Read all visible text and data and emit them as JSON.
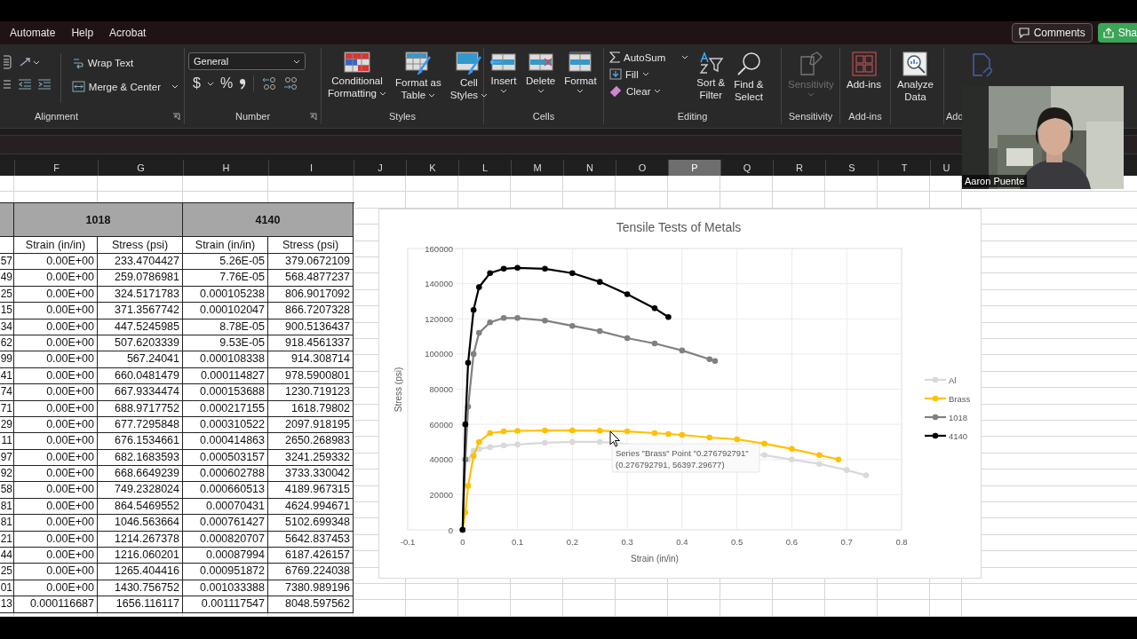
{
  "menu_tabs": [
    {
      "label": "Automate"
    },
    {
      "label": "Help"
    },
    {
      "label": "Acrobat"
    }
  ],
  "menubar": {
    "comments": "Comments",
    "share": "Sha"
  },
  "ribbon": {
    "alignment": {
      "wrap_text": "Wrap Text",
      "merge_center": "Merge & Center",
      "label": "Alignment"
    },
    "number": {
      "format": "General",
      "currency": "$",
      "percent": "%",
      "label": "Number"
    },
    "styles": {
      "buttons": [
        {
          "lines": [
            "Conditional",
            "Formatting"
          ]
        },
        {
          "lines": [
            "Format as",
            "Table"
          ]
        },
        {
          "lines": [
            "Cell",
            "Styles"
          ]
        }
      ],
      "label": "Styles"
    },
    "cells": {
      "buttons": [
        {
          "label": "Insert"
        },
        {
          "label": "Delete"
        },
        {
          "label": "Format"
        }
      ],
      "label": "Cells"
    },
    "editing": {
      "autosum": "AutoSum",
      "fill": "Fill",
      "clear": "Clear",
      "sort": [
        "Sort &",
        "Filter"
      ],
      "find": [
        "Find &",
        "Select"
      ],
      "label": "Editing"
    },
    "sensitivity": {
      "button": "Sensitivity",
      "disabled": true,
      "label": "Sensitivity"
    },
    "addins": {
      "button": "Add-ins",
      "label": "Add-ins"
    },
    "analyze": {
      "lines": [
        "Analyze",
        "Data"
      ]
    },
    "partial_group": {
      "label": "Add"
    }
  },
  "column_headers": [
    {
      "letter": "F",
      "selected": false
    },
    {
      "letter": "G",
      "selected": false
    },
    {
      "letter": "H",
      "selected": false
    },
    {
      "letter": "I",
      "selected": false
    },
    {
      "letter": "J",
      "selected": false
    },
    {
      "letter": "K",
      "selected": false
    },
    {
      "letter": "L",
      "selected": false
    },
    {
      "letter": "M",
      "selected": false
    },
    {
      "letter": "N",
      "selected": false
    },
    {
      "letter": "O",
      "selected": false
    },
    {
      "letter": "P",
      "selected": true
    },
    {
      "letter": "Q",
      "selected": false
    },
    {
      "letter": "R",
      "selected": false
    },
    {
      "letter": "S",
      "selected": false
    },
    {
      "letter": "T",
      "selected": false
    },
    {
      "letter": "U",
      "selected": false
    }
  ],
  "table": {
    "groups": [
      "1018",
      "4140"
    ],
    "columns": [
      "",
      "Strain (in/in)",
      "Stress (psi)",
      "Strain (in/in)",
      "Stress (psi)"
    ],
    "rows": [
      [
        "57",
        "0.00E+00",
        "233.4704427",
        "5.26E-05",
        "379.0672109"
      ],
      [
        "49",
        "0.00E+00",
        "259.0786981",
        "7.76E-05",
        "568.4877237"
      ],
      [
        "25",
        "0.00E+00",
        "324.5171783",
        "0.000105238",
        "806.9017092"
      ],
      [
        "15",
        "0.00E+00",
        "371.3567742",
        "0.000102047",
        "866.7207328"
      ],
      [
        "34",
        "0.00E+00",
        "447.5245985",
        "8.78E-05",
        "900.5136437"
      ],
      [
        "62",
        "0.00E+00",
        "507.6203339",
        "9.53E-05",
        "918.4561337"
      ],
      [
        "99",
        "0.00E+00",
        "567.24041",
        "0.000108338",
        "914.308714"
      ],
      [
        "41",
        "0.00E+00",
        "660.0481479",
        "0.000114827",
        "978.5900801"
      ],
      [
        "74",
        "0.00E+00",
        "667.9334474",
        "0.000153688",
        "1230.719123"
      ],
      [
        "71",
        "0.00E+00",
        "688.9717752",
        "0.000217155",
        "1618.79802"
      ],
      [
        "29",
        "0.00E+00",
        "677.7295848",
        "0.000310522",
        "2097.918195"
      ],
      [
        "11",
        "0.00E+00",
        "676.1534661",
        "0.000414863",
        "2650.268983"
      ],
      [
        "97",
        "0.00E+00",
        "682.1683593",
        "0.000503157",
        "3241.259332"
      ],
      [
        "92",
        "0.00E+00",
        "668.6649239",
        "0.000602788",
        "3733.330042"
      ],
      [
        "58",
        "0.00E+00",
        "749.2328024",
        "0.000660513",
        "4189.967315"
      ],
      [
        "81",
        "0.00E+00",
        "864.5469552",
        "0.00070431",
        "4624.994671"
      ],
      [
        "81",
        "0.00E+00",
        "1046.563664",
        "0.000761427",
        "5102.699348"
      ],
      [
        "21",
        "0.00E+00",
        "1214.267378",
        "0.000820707",
        "5642.837453"
      ],
      [
        "44",
        "0.00E+00",
        "1216.060201",
        "0.00087994",
        "6187.426157"
      ],
      [
        "25",
        "0.00E+00",
        "1265.404416",
        "0.000951872",
        "6769.224038"
      ],
      [
        "01",
        "0.00E+00",
        "1430.756752",
        "0.001033388",
        "7380.989196"
      ],
      [
        "13",
        "0.000116687",
        "1656.116117",
        "0.001117547",
        "8048.597562"
      ]
    ]
  },
  "chart": {
    "chart_data": {
      "type": "line",
      "title": "Tensile Tests of Metals",
      "xlabel": "Strain (in/in)",
      "ylabel": "Stress (psi)",
      "x": [
        0,
        0.005,
        0.01,
        0.02,
        0.03,
        0.05,
        0.075,
        0.1,
        0.15,
        0.2,
        0.25,
        0.3,
        0.35,
        0.375,
        0.4,
        0.45,
        0.46,
        0.5,
        0.55,
        0.6,
        0.65,
        0.685,
        0.7,
        0.735
      ],
      "series": [
        {
          "name": "Al",
          "color": "#d9d9d9",
          "marker": "circle",
          "values": [
            null,
            null,
            40000,
            45000,
            46000,
            47000,
            48000,
            48500,
            49500,
            50000,
            50000,
            null,
            null,
            null,
            null,
            null,
            null,
            null,
            42500,
            40000,
            37500,
            null,
            34000,
            31000
          ]
        },
        {
          "name": "Brass",
          "color": "#ffc000",
          "marker": "circle",
          "values": [
            0,
            10000,
            25000,
            42000,
            50000,
            55000,
            56000,
            56300,
            56500,
            56500,
            56400,
            56000,
            55000,
            54500,
            54000,
            52500,
            null,
            51500,
            49000,
            46000,
            42500,
            40000,
            null,
            null
          ]
        },
        {
          "name": "1018",
          "color": "#808080",
          "marker": "circle",
          "values": [
            0,
            40000,
            70000,
            100000,
            112000,
            118000,
            120500,
            120500,
            119000,
            116000,
            113000,
            109000,
            106000,
            null,
            102000,
            97000,
            96000,
            null,
            null,
            null,
            null,
            null,
            null,
            null
          ]
        },
        {
          "name": "4140",
          "color": "#000000",
          "marker": "circle",
          "values": [
            0,
            60000,
            95000,
            125000,
            138000,
            146000,
            148500,
            149000,
            148500,
            146000,
            141000,
            134000,
            126000,
            121000,
            null,
            null,
            null,
            null,
            null,
            null,
            null,
            null,
            null,
            null
          ]
        }
      ],
      "xlim": [
        -0.1,
        0.8
      ],
      "ylim": [
        0,
        160000
      ],
      "xticks": [
        -0.1,
        0,
        0.1,
        0.2,
        0.3,
        0.4,
        0.5,
        0.6,
        0.7,
        0.8
      ],
      "yticks": [
        0,
        20000,
        40000,
        60000,
        80000,
        100000,
        120000,
        140000,
        160000
      ],
      "grid": true,
      "legend": true
    },
    "tooltip": [
      "Series \"Brass\" Point \"0.276792791\"",
      "(0.276792791, 56397.29677)"
    ]
  },
  "webcam": {
    "name": "Aaron Puente"
  }
}
